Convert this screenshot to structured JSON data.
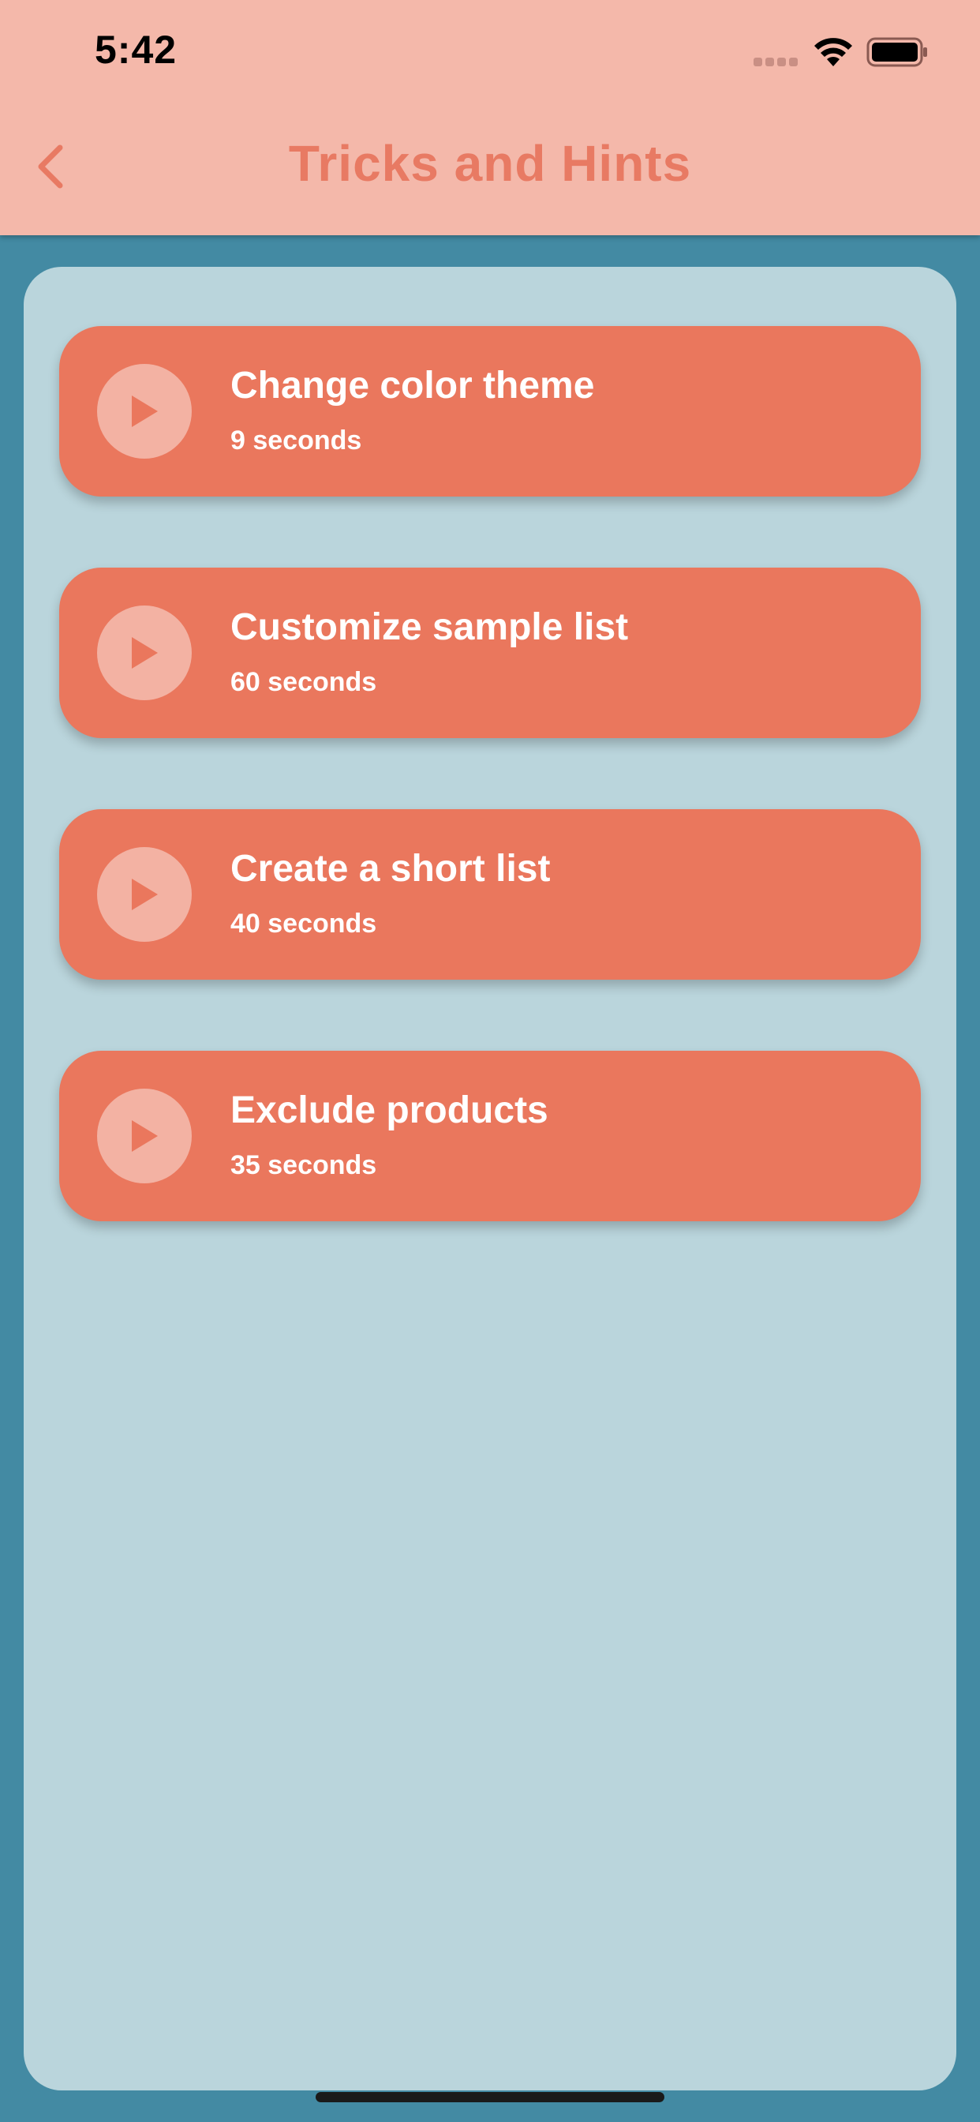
{
  "status_bar": {
    "time": "5:42"
  },
  "header": {
    "title": "Tricks and Hints",
    "back_icon": "chevron-left-icon"
  },
  "colors": {
    "header_bg": "#f4b8aa",
    "accent": "#e87a63",
    "card_bg": "#ea775d",
    "panel_bg": "#bad5dc",
    "page_bg": "#438aa3"
  },
  "hints": [
    {
      "title": "Change color theme",
      "duration": "9 seconds"
    },
    {
      "title": "Customize sample list",
      "duration": "60 seconds"
    },
    {
      "title": "Create a short list",
      "duration": "40 seconds"
    },
    {
      "title": "Exclude products",
      "duration": "35 seconds"
    }
  ]
}
